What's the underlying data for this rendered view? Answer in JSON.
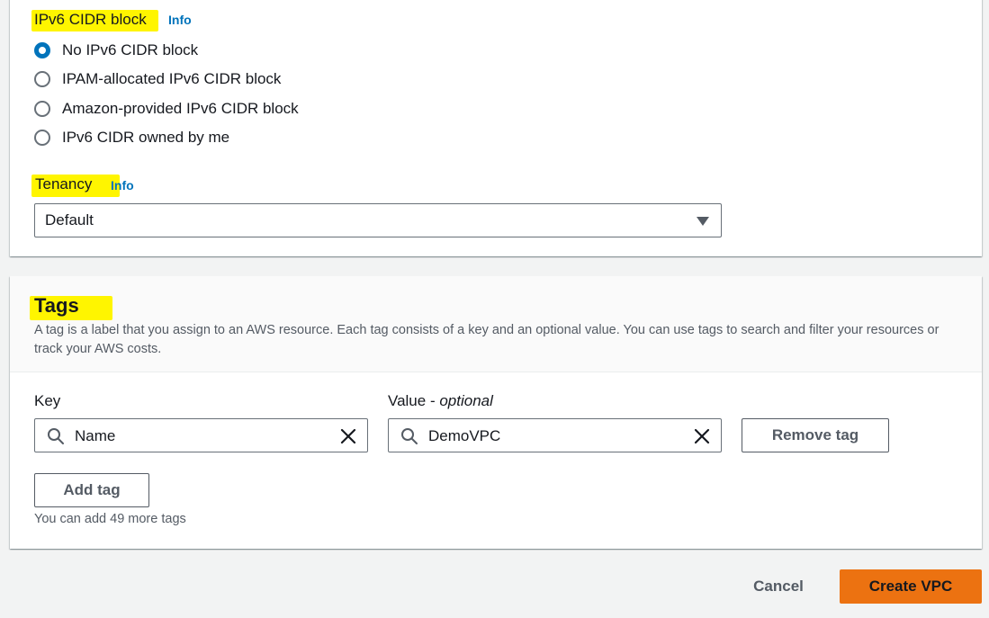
{
  "ipv6": {
    "label": "IPv6 CIDR block",
    "info": "Info",
    "options": [
      {
        "label": "No IPv6 CIDR block",
        "checked": true
      },
      {
        "label": "IPAM-allocated IPv6 CIDR block",
        "checked": false
      },
      {
        "label": "Amazon-provided IPv6 CIDR block",
        "checked": false
      },
      {
        "label": "IPv6 CIDR owned by me",
        "checked": false
      }
    ]
  },
  "tenancy": {
    "label": "Tenancy",
    "info": "Info",
    "selected": "Default"
  },
  "tags": {
    "title": "Tags",
    "description": "A tag is a label that you assign to an AWS resource. Each tag consists of a key and an optional value. You can use tags to search and filter your resources or track your AWS costs.",
    "key_label": "Key",
    "value_label": "Value - ",
    "value_label_optional": "optional",
    "key_value": "Name",
    "value_value": "DemoVPC",
    "remove_label": "Remove tag",
    "add_label": "Add tag",
    "hint": "You can add 49 more tags"
  },
  "footer": {
    "cancel_label": "Cancel",
    "create_label": "Create VPC"
  },
  "colors": {
    "highlight": "#fff500",
    "link": "#0073bb",
    "primary_button": "#ec7211",
    "page_bg": "#f2f3f3"
  }
}
